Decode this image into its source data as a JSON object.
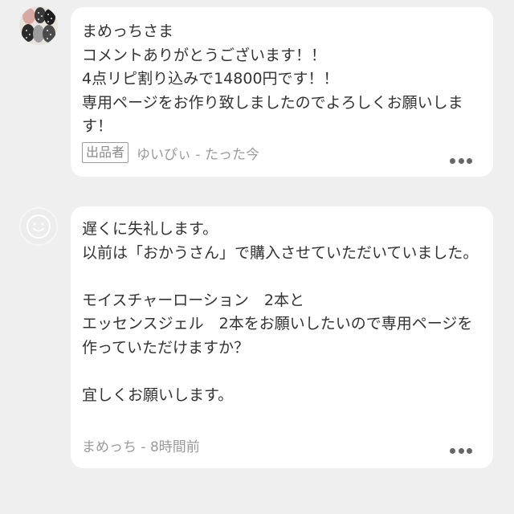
{
  "comments": [
    {
      "text": "まめっちさま\nコメントありがとうございます！！\n4点リピ割り込みで14800円です！！\n専用ページをお作り致しましたのでよろしくお願いします！",
      "badge": "出品者",
      "author_time": "ゆいぴぃ - たった今",
      "avatar": "patterned-avatar-icon"
    },
    {
      "text": "遅くに失礼します。\n以前は「おかうさん」で購入させていただいていました。\n\nモイスチャーローション　2本と\nエッセンスジェル　2本をお願いしたいので専用ページを作っていただけますか？\n\n宜しくお願いします。",
      "author_time": "まめっち - 8時間前",
      "avatar": "default-face-avatar-icon"
    }
  ]
}
